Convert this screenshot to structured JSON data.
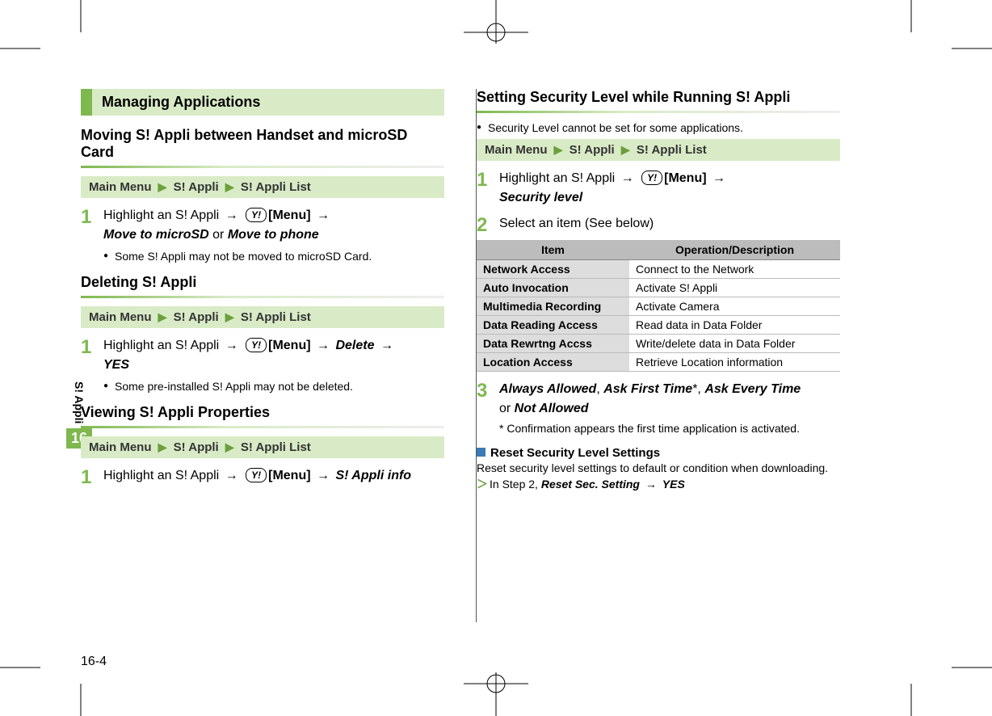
{
  "side": {
    "label": "S! Appli",
    "chapter": "16"
  },
  "pageNumber": "16-4",
  "left": {
    "banner": "Managing Applications",
    "sections": [
      {
        "heading": "Moving S! Appli between Handset and microSD Card",
        "breadcrumb": [
          "Main Menu",
          "S! Appli",
          "S! Appli List"
        ],
        "step": {
          "num": "1",
          "pre": "Highlight an S! Appli",
          "menu": "[Menu]",
          "opt1": "Move to microSD",
          "or": " or ",
          "opt2": "Move to phone"
        },
        "note": "Some S! Appli may not be moved to microSD Card."
      },
      {
        "heading": "Deleting S! Appli",
        "breadcrumb": [
          "Main Menu",
          "S! Appli",
          "S! Appli List"
        ],
        "step": {
          "num": "1",
          "pre": "Highlight an S! Appli",
          "menu": "[Menu]",
          "opt1": "Delete",
          "opt2": "YES"
        },
        "note": "Some pre-installed S! Appli may not be deleted."
      },
      {
        "heading": "Viewing S! Appli Properties",
        "breadcrumb": [
          "Main Menu",
          "S! Appli",
          "S! Appli List"
        ],
        "step": {
          "num": "1",
          "pre": "Highlight an S! Appli",
          "menu": "[Menu]",
          "opt1": "S! Appli info"
        }
      }
    ]
  },
  "right": {
    "heading": "Setting Security Level while Running S! Appli",
    "topnote": "Security Level cannot be set for some applications.",
    "breadcrumb": [
      "Main Menu",
      "S! Appli",
      "S! Appli List"
    ],
    "step1": {
      "num": "1",
      "pre": "Highlight an S! Appli",
      "menu": "[Menu]",
      "opt1": "Security level"
    },
    "step2": {
      "num": "2",
      "text": "Select an item (See below)"
    },
    "table": {
      "headers": [
        "Item",
        "Operation/Description"
      ],
      "rows": [
        [
          "Network Access",
          "Connect to the Network"
        ],
        [
          "Auto Invocation",
          "Activate S! Appli"
        ],
        [
          "Multimedia Recording",
          "Activate Camera"
        ],
        [
          "Data Reading Access",
          "Read data in Data Folder"
        ],
        [
          "Data Rewrtng Accss",
          "Write/delete data in Data Folder"
        ],
        [
          "Location Access",
          "Retrieve Location information"
        ]
      ]
    },
    "step3": {
      "num": "3",
      "options": [
        "Always Allowed",
        "Ask First Time",
        "Ask Every Time",
        "Not Allowed"
      ],
      "or": " or ",
      "comma": ", ",
      "star": "*",
      "footnote": "* Confirmation appears the first time application is activated."
    },
    "reset": {
      "heading": "Reset Security Level Settings",
      "text": "Reset security level settings to default or condition when downloading.",
      "instep": "In Step 2, ",
      "opt1": "Reset Sec. Setting",
      "opt2": "YES"
    }
  }
}
